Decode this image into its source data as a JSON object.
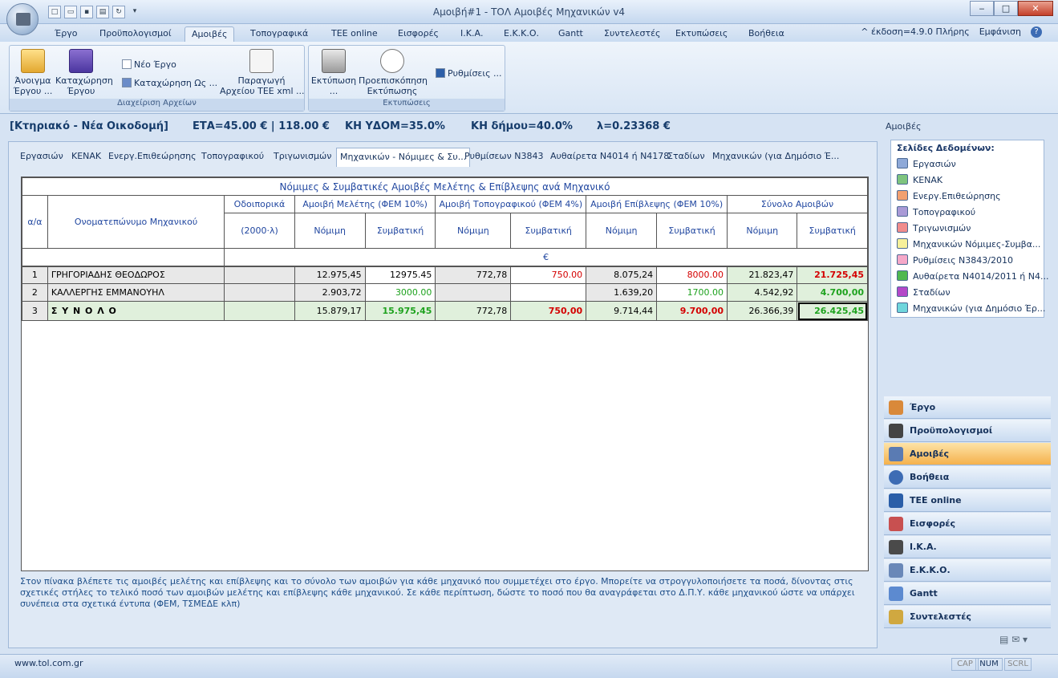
{
  "window": {
    "title": "Αμοιβή#1 - ΤΟΛ Αμοιβές Μηχανικών v4",
    "minimize": "‒",
    "maximize": "□",
    "close": "✕"
  },
  "ribbon_tabs": [
    "Έργο",
    "Προϋπολογισμοί",
    "Αμοιβές",
    "Τοπογραφικά",
    "TEE online",
    "Εισφορές",
    "Ι.Κ.Α.",
    "Ε.Κ.Κ.Ο.",
    "Gantt",
    "Συντελεστές",
    "Εκτυπώσεις",
    "Βοήθεια"
  ],
  "active_ribbon_tab": "Αμοιβές",
  "version_info": "^ έκδοση=4.9.0 Πλήρης",
  "appearance": "Εμφάνιση",
  "help_glyph": "?",
  "ribbon": {
    "group_files": {
      "label": "Διαχείριση Αρχείων",
      "open": "Άνοιγμα\nΈργου ...",
      "save": "Καταχώρηση\nΈργου",
      "new": "Νέο Έργο",
      "save_as": "Καταχώρηση Ως ...",
      "xml": "Παραγωγή\nΑρχείου ΤΕΕ xml ..."
    },
    "group_print": {
      "label": "Εκτυπώσεις",
      "print": "Εκτύπωση\n...",
      "preview": "Προεπισκόπηση\nΕκτύπωσης",
      "settings": "Ρυθμίσεις ..."
    }
  },
  "infobar": {
    "project": "[Κτηριακό - Νέα Οικοδομή]",
    "eta": "ΕΤΑ=45.00 € | 118.00 €",
    "kh_ydom": "ΚΗ ΥΔΟΜ=35.0%",
    "kh_dimou": "ΚΗ δήμου=40.0%",
    "lambda": "λ=0.23368 €"
  },
  "content_tabs": [
    "Εργασιών",
    "ΚΕΝΑΚ",
    "Ενεργ.Επιθεώρησης",
    "Τοπογραφικού",
    "Τριγωνισμών",
    "Μηχανικών - Νόμιμες & Συ...",
    "Ρυθμίσεων Ν3843",
    "Αυθαίρετα Ν4014 ή Ν4178",
    "Σταδίων",
    "Μηχανικών (για Δημόσιο Έ..."
  ],
  "active_content_tab": 5,
  "table": {
    "title": "Νόμιμες & Συμβατικές Αμοιβές Μελέτης & Επίβλεψης ανά Μηχανικό",
    "col_aa": "α/α",
    "col_name": "Ονοματεπώνυμο Μηχανικού",
    "col_travel": "Οδοιπορικά",
    "col_travel_unit": "(2000·λ)",
    "grp_study": "Αμοιβή Μελέτης (ΦΕΜ 10%)",
    "grp_topo": "Αμοιβή Τοπογραφικού (ΦΕΜ 4%)",
    "grp_supervision": "Αμοιβή Επίβλεψης (ΦΕΜ 10%)",
    "grp_total": "Σύνολο Αμοιβών",
    "sub_legal": "Νόμιμη",
    "sub_contract": "Συμβατική",
    "currency": "€",
    "rows": [
      {
        "aa": "1",
        "name": "ΓΡΗΓΟΡΙΑΔΗΣ ΘΕΟΔΩΡΟΣ",
        "travel": "",
        "study_legal": "12.975,45",
        "study_contract": "12975.45",
        "topo_legal": "772,78",
        "topo_contract": "750.00",
        "sup_legal": "8.075,24",
        "sup_contract": "8000.00",
        "tot_legal": "21.823,47",
        "tot_contract": "21.725,45"
      },
      {
        "aa": "2",
        "name": "ΚΑΛΛΕΡΓΗΣ ΕΜΜΑΝΟΥΗΛ",
        "travel": "",
        "study_legal": "2.903,72",
        "study_contract": "3000.00",
        "topo_legal": "",
        "topo_contract": "",
        "sup_legal": "1.639,20",
        "sup_contract": "1700.00",
        "tot_legal": "4.542,92",
        "tot_contract": "4.700,00"
      },
      {
        "aa": "3",
        "name": "Σ Υ Ν Ο Λ Ο",
        "travel": "",
        "study_legal": "15.879,17",
        "study_contract": "15.975,45",
        "topo_legal": "772,78",
        "topo_contract": "750,00",
        "sup_legal": "9.714,44",
        "sup_contract": "9.700,00",
        "tot_legal": "26.366,39",
        "tot_contract": "26.425,45"
      }
    ]
  },
  "description": "Στον πίνακα βλέπετε τις αμοιβές μελέτης και επίβλεψης και το σύνολο των αμοιβών για κάθε μηχανικό που συμμετέχει στο έργο. Μπορείτε να στρογγυλοποιήσετε τα ποσά, δίνοντας στις σχετικές στήλες το τελικό ποσό των αμοιβών μελέτης και επίβλεψης κάθε μηχανικού. Σε κάθε περίπτωση, δώστε το ποσό που θα αναγράφεται στο Δ.Π.Υ. κάθε μηχανικού ώστε να υπάρχει συνέπεια στα σχετικά έντυπα (ΦΕΜ, ΤΣΜΕΔΕ κλπ)",
  "right_pane": {
    "title": "Αμοιβές",
    "list_header": "Σελίδες Δεδομένων:",
    "items": [
      {
        "label": "Εργασιών",
        "color": "#8ea9d8"
      },
      {
        "label": "ΚΕΝΑΚ",
        "color": "#7ec47e"
      },
      {
        "label": "Ενεργ.Επιθεώρησης",
        "color": "#f2a070"
      },
      {
        "label": "Τοπογραφικού",
        "color": "#a99ad6"
      },
      {
        "label": "Τριγωνισμών",
        "color": "#f08c8c"
      },
      {
        "label": "Μηχανικών Νόμιμες-Συμβα...",
        "color": "#f7f09a"
      },
      {
        "label": "Ρυθμίσεις Ν3843/2010",
        "color": "#f5a8c8"
      },
      {
        "label": "Αυθαίρετα Ν4014/2011 ή Ν4...",
        "color": "#4fb84f"
      },
      {
        "label": "Σταδίων",
        "color": "#b448c8"
      },
      {
        "label": "Μηχανικών (για Δημόσιο Έρ...",
        "color": "#6fd6dc"
      }
    ]
  },
  "nav": [
    {
      "label": "Έργο",
      "icon": "house-icon",
      "color": "#d9893a"
    },
    {
      "label": "Προϋπολογισμοί",
      "icon": "sigma-icon",
      "color": "#444"
    },
    {
      "label": "Αμοιβές",
      "icon": "people-icon",
      "color": "#5a7bb3"
    },
    {
      "label": "Βοήθεια",
      "icon": "help-icon",
      "color": "#3d6cb4"
    },
    {
      "label": "TEE online",
      "icon": "tee-icon",
      "color": "#2a5ea8"
    },
    {
      "label": "Εισφορές",
      "icon": "document-icon",
      "color": "#c85050"
    },
    {
      "label": "Ι.Κ.Α.",
      "icon": "ika-icon",
      "color": "#4a4a4a"
    },
    {
      "label": "Ε.Κ.Κ.Ο.",
      "icon": "document-icon",
      "color": "#6a88b8"
    },
    {
      "label": "Gantt",
      "icon": "gantt-icon",
      "color": "#5c8ad0"
    },
    {
      "label": "Συντελεστές",
      "icon": "table-icon",
      "color": "#d0a840"
    }
  ],
  "active_nav": "Αμοιβές",
  "status": {
    "url": "www.tol.com.gr",
    "cap": "CAP",
    "num": "NUM",
    "scrl": "SCRL"
  }
}
